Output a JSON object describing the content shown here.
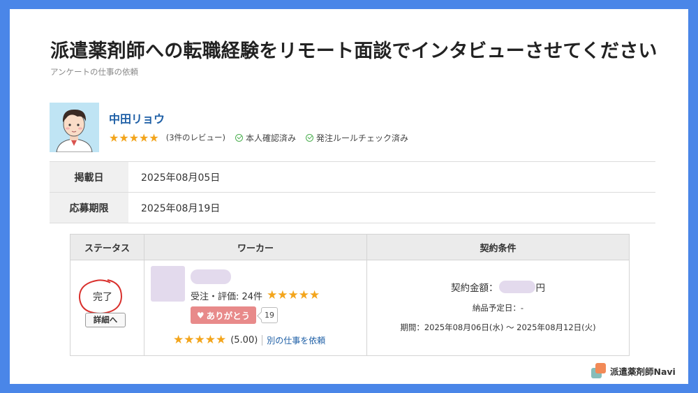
{
  "page": {
    "title": "派遣薬剤師への転職経験をリモート面談でインタビューさせてください",
    "category": "アンケートの仕事の依頼"
  },
  "client": {
    "name": "中田リョウ",
    "stars": "★★★★★",
    "reviews": "(3件のレビュー)",
    "identity_verified": "本人確認済み",
    "order_rules_checked": "発注ルールチェック済み"
  },
  "job_info": {
    "posted_label": "掲載日",
    "posted_value": "2025年08月05日",
    "deadline_label": "応募期限",
    "deadline_value": "2025年08月19日"
  },
  "work_table": {
    "headers": [
      "ステータス",
      "ワーカー",
      "契約条件"
    ],
    "status": "完了",
    "detail_button": "詳細へ",
    "worker": {
      "orders_rating": "受注・評価: 24件",
      "stars": "★★★★★",
      "thanks_label": "ありがとう",
      "thanks_count": "19",
      "rating_stars": "★★★★★",
      "rating_value": "(5.00)",
      "request_link": "別の仕事を依頼"
    },
    "contract": {
      "amount_label": "契約金額：",
      "amount_unit": "円",
      "delivery": "納品予定日：-",
      "period": "期間：2025年08月06日(水) 〜 2025年08月12日(火)"
    }
  },
  "brand": {
    "logo_text": "派遣薬剤師Navi"
  },
  "colors": {
    "frame": "#4a86e8",
    "star": "#f3a51c",
    "link": "#1e5fa6",
    "thanks": "#e88a8a",
    "annotation_circle": "#d9302c"
  }
}
